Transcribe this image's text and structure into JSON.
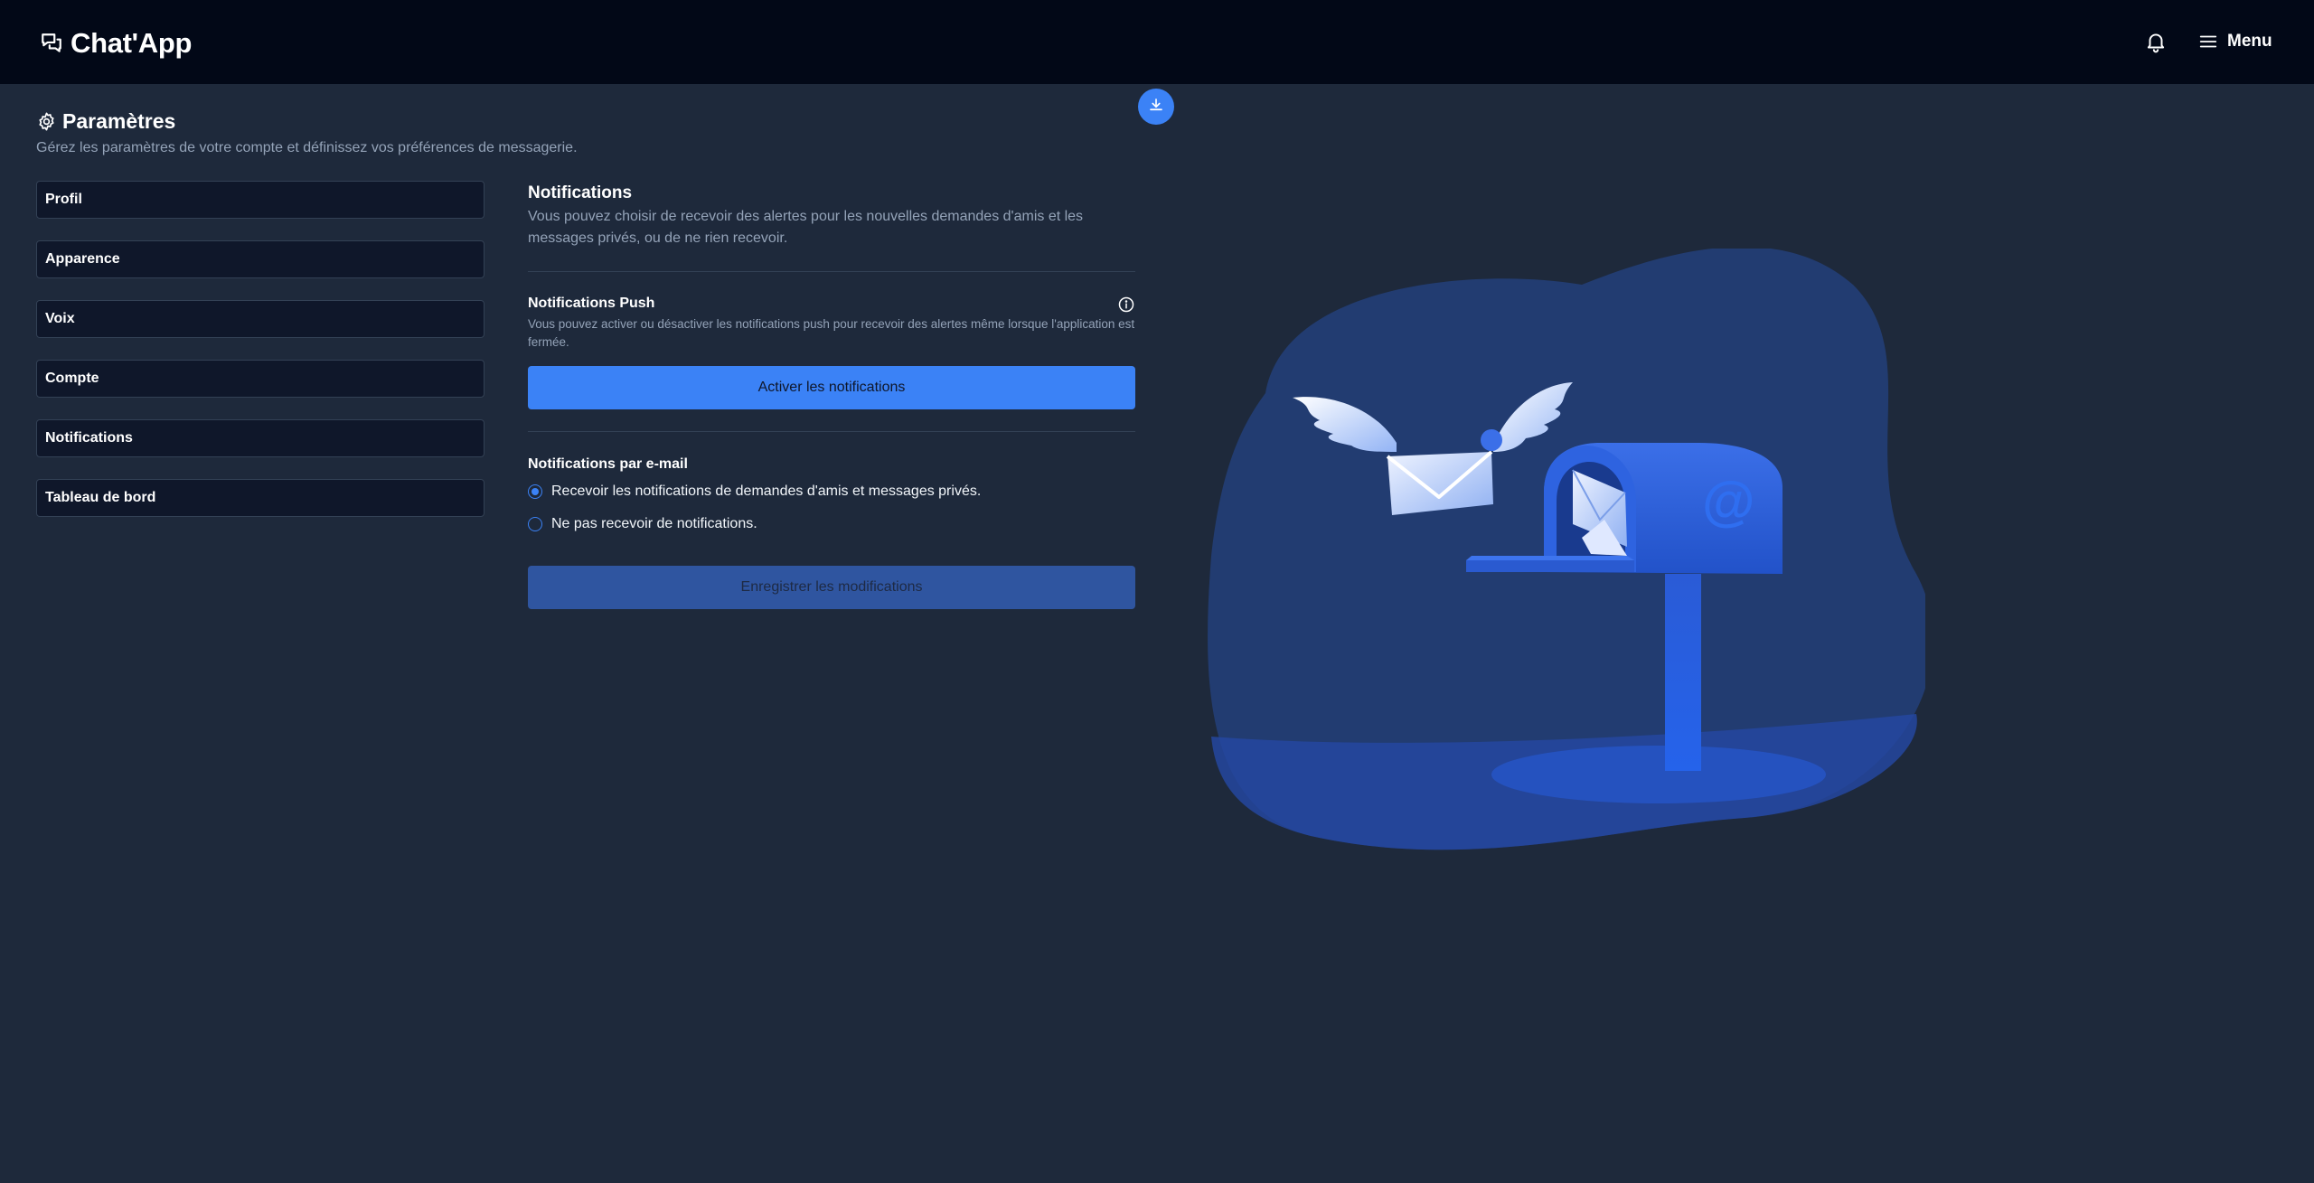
{
  "header": {
    "app_name": "Chat'App",
    "logo_icon": "chat-bubbles-icon",
    "bell_icon": "bell-icon",
    "menu_icon": "hamburger-icon",
    "menu_label": "Menu"
  },
  "fab": {
    "icon": "download-icon"
  },
  "page": {
    "title_icon": "gear-icon",
    "title": "Paramètres",
    "subtitle": "Gérez les paramètres de votre compte et définissez vos préférences de messagerie."
  },
  "sidebar": {
    "items": [
      {
        "label": "Profil"
      },
      {
        "label": "Apparence"
      },
      {
        "label": "Voix"
      },
      {
        "label": "Compte"
      },
      {
        "label": "Notifications"
      },
      {
        "label": "Tableau de bord"
      }
    ]
  },
  "notifications": {
    "title": "Notifications",
    "description": "Vous pouvez choisir de recevoir des alertes pour les nouvelles demandes d'amis et les messages privés, ou de ne rien recevoir.",
    "push": {
      "title": "Notifications Push",
      "info_icon": "info-icon",
      "description": "Vous pouvez activer ou désactiver les notifications push pour recevoir des alertes même lorsque l'application est fermée.",
      "button_label": "Activer les notifications"
    },
    "email": {
      "title": "Notifications par e-mail",
      "options": [
        {
          "label": "Recevoir les notifications de demandes d'amis et messages privés.",
          "selected": true
        },
        {
          "label": "Ne pas recevoir de notifications.",
          "selected": false
        }
      ]
    },
    "save_label": "Enregistrer les modifications"
  },
  "illustration": {
    "icon": "mailbox-flying-envelope-illustration",
    "mailbox_symbol": "@"
  },
  "colors": {
    "accent": "#3b82f6",
    "background": "#1e293b",
    "header": "#020817",
    "panel": "#0f172a",
    "muted_text": "#94a3b8"
  }
}
